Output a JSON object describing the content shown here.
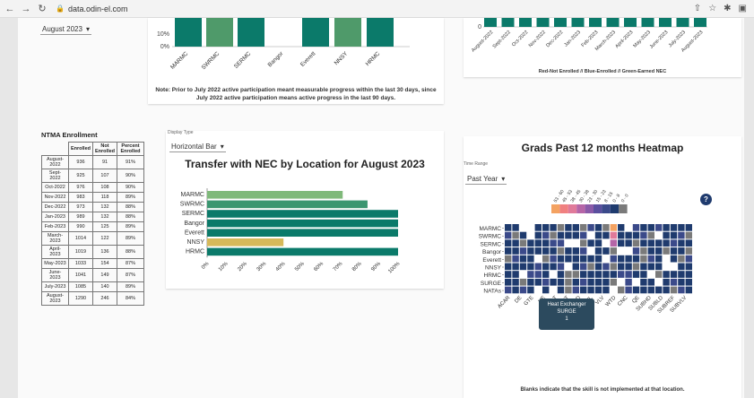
{
  "browser": {
    "url": "data.odin-el.com"
  },
  "top_left": {
    "month_select": "August 2023"
  },
  "participation_chart": {
    "ytick_10": "10%",
    "ytick_0": "0%",
    "categories": [
      "MARMC",
      "SWRMC",
      "SERMC",
      "Bangor",
      "Everett",
      "NNSY",
      "HRMC"
    ],
    "note": "Note: Prior to July 2022 active participation meant measurable progress within the last 30 days, since July 2022 active participation means active progress in the last 90 days."
  },
  "monthly_chart": {
    "ytick_0": "0",
    "months": [
      "August-2022",
      "Sept-2022",
      "Oct-2022",
      "Nov-2022",
      "Dec-2022",
      "Jan-2023",
      "Feb-2023",
      "March-2023",
      "April-2023",
      "May-2023",
      "June-2023",
      "July-2023",
      "August-2023"
    ],
    "legend": "Red-Not Enrolled // Blue-Enrolled // Green-Earned NEC"
  },
  "ntma": {
    "title": "NTMA Enrollment",
    "headers": [
      "",
      "Enrolled",
      "Not Enrolled",
      "Percent Enrolled"
    ],
    "rows": [
      [
        "August-2022",
        "936",
        "91",
        "91%"
      ],
      [
        "Sept-2022",
        "925",
        "107",
        "90%"
      ],
      [
        "Oct-2022",
        "976",
        "108",
        "90%"
      ],
      [
        "Nov-2022",
        "983",
        "118",
        "89%"
      ],
      [
        "Dec-2022",
        "973",
        "132",
        "88%"
      ],
      [
        "Jan-2023",
        "989",
        "132",
        "88%"
      ],
      [
        "Feb-2023",
        "990",
        "125",
        "89%"
      ],
      [
        "March-2023",
        "1014",
        "122",
        "89%"
      ],
      [
        "April-2023",
        "1019",
        "136",
        "88%"
      ],
      [
        "May-2023",
        "1033",
        "154",
        "87%"
      ],
      [
        "June-2023",
        "1041",
        "149",
        "87%"
      ],
      [
        "July-2023",
        "1085",
        "140",
        "89%"
      ],
      [
        "August-2023",
        "1290",
        "246",
        "84%"
      ]
    ]
  },
  "transfer": {
    "display_type_label": "Display Type",
    "display_type_value": "Horizontal Bar",
    "title": "Transfer with NEC by Location for August 2023",
    "xticks": [
      "0%",
      "10%",
      "20%",
      "30%",
      "40%",
      "50%",
      "60%",
      "70%",
      "80%",
      "90%",
      "100%"
    ]
  },
  "chart_data": {
    "type": "bar",
    "orientation": "horizontal",
    "title": "Transfer with NEC by Location for August 2023",
    "categories": [
      "MARMC",
      "SWRMC",
      "SERMC",
      "Bangor",
      "Everett",
      "NNSY",
      "HRMC"
    ],
    "values": [
      71,
      84,
      100,
      100,
      100,
      40,
      100
    ],
    "colors": [
      "#7fb97a",
      "#3a9670",
      "#0b7a6a",
      "#0b7a6a",
      "#0b7a6a",
      "#d6b95a",
      "#0b7a6a"
    ],
    "xlim": [
      0,
      100
    ]
  },
  "heatmap": {
    "title": "Grads Past 12 months Heatmap",
    "time_range_label": "Time Range",
    "time_range_value": "Past Year",
    "legend_ranges": [
      "53 - 60",
      "45 - 53",
      "38 - 45",
      "30 - 38",
      "23 - 30",
      "15 - 23",
      "8 - 15",
      "0 - 8",
      "0 - 0"
    ],
    "legend_colors": [
      "#f4a261",
      "#f08080",
      "#e07a9a",
      "#b565a7",
      "#8a5aa8",
      "#5a4f9e",
      "#3b4a8a",
      "#1f3b6e",
      "#7a7a7a"
    ],
    "rows": [
      "MARMC",
      "SWRMC",
      "SERMC",
      "Bangor",
      "Everett",
      "NNSY",
      "HRMC",
      "SURGE",
      "NATAs"
    ],
    "xlabels": [
      "ACAR",
      "DE",
      "GTE",
      "HE",
      "FOT",
      "RST",
      "SHRD",
      "SIL",
      "VLV",
      "WTD",
      "CNC",
      "QE",
      "SUBHD",
      "SUBLD",
      "SUBREF",
      "SUBVLV"
    ],
    "tooltip": {
      "title": "Heat Exchanger",
      "row": "SURGE",
      "value": "1"
    },
    "help": "?",
    "footer": "Blanks indicate that the skill is not implemented at that location."
  }
}
